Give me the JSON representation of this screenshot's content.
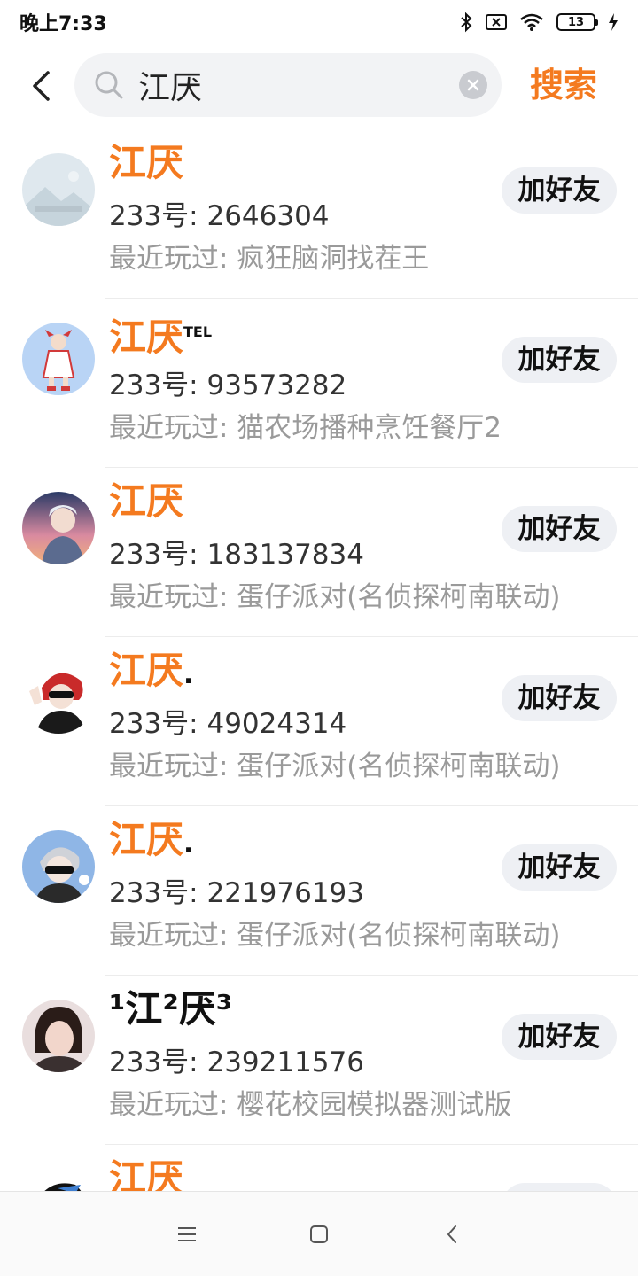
{
  "status_bar": {
    "time": "晚上7:33",
    "battery_level": "13",
    "icons": [
      "bluetooth-icon",
      "sim-disabled-icon",
      "wifi-icon",
      "battery-icon",
      "charging-icon"
    ]
  },
  "search": {
    "query": "江厌",
    "button_label": "搜索"
  },
  "colors": {
    "accent": "#f47a1f",
    "button_bg": "#eef0f4",
    "secondary_text": "#9a9a9a"
  },
  "results": [
    {
      "name": "江厌",
      "suffix": "",
      "id": "233号: 2646304",
      "recent": "最近玩过: 疯狂脑洞找茬王",
      "button": "加好友",
      "avatar": "placeholder-landscape"
    },
    {
      "name": "江厌",
      "suffix": "TEL",
      "id": "233号: 93573282",
      "recent": "最近玩过: 猫农场播种烹饪餐厅2",
      "button": "加好友",
      "avatar": "anime-girl-red"
    },
    {
      "name": "江厌",
      "suffix": "",
      "id": "233号: 183137834",
      "recent": "最近玩过: 蛋仔派对(名侦探柯南联动)",
      "button": "加好友",
      "avatar": "anime-boy-sunset"
    },
    {
      "name": "江厌",
      "suffix": ".",
      "id": "233号: 49024314",
      "recent": "最近玩过: 蛋仔派对(名侦探柯南联动)",
      "button": "加好友",
      "avatar": "anime-boy-redhair"
    },
    {
      "name": "江厌",
      "suffix": ".",
      "id": "233号: 221976193",
      "recent": "最近玩过: 蛋仔派对(名侦探柯南联动)",
      "button": "加好友",
      "avatar": "anime-boy-sunglasses"
    },
    {
      "name": "¹江²厌³",
      "suffix": "",
      "id": "233号: 239211576",
      "recent": "最近玩过: 樱花校园模拟器测试版",
      "button": "加好友",
      "avatar": "photo-person"
    },
    {
      "name": "江厌",
      "suffix": "",
      "id": "",
      "recent": "",
      "button": "加好友",
      "avatar": "anime-dark"
    }
  ]
}
